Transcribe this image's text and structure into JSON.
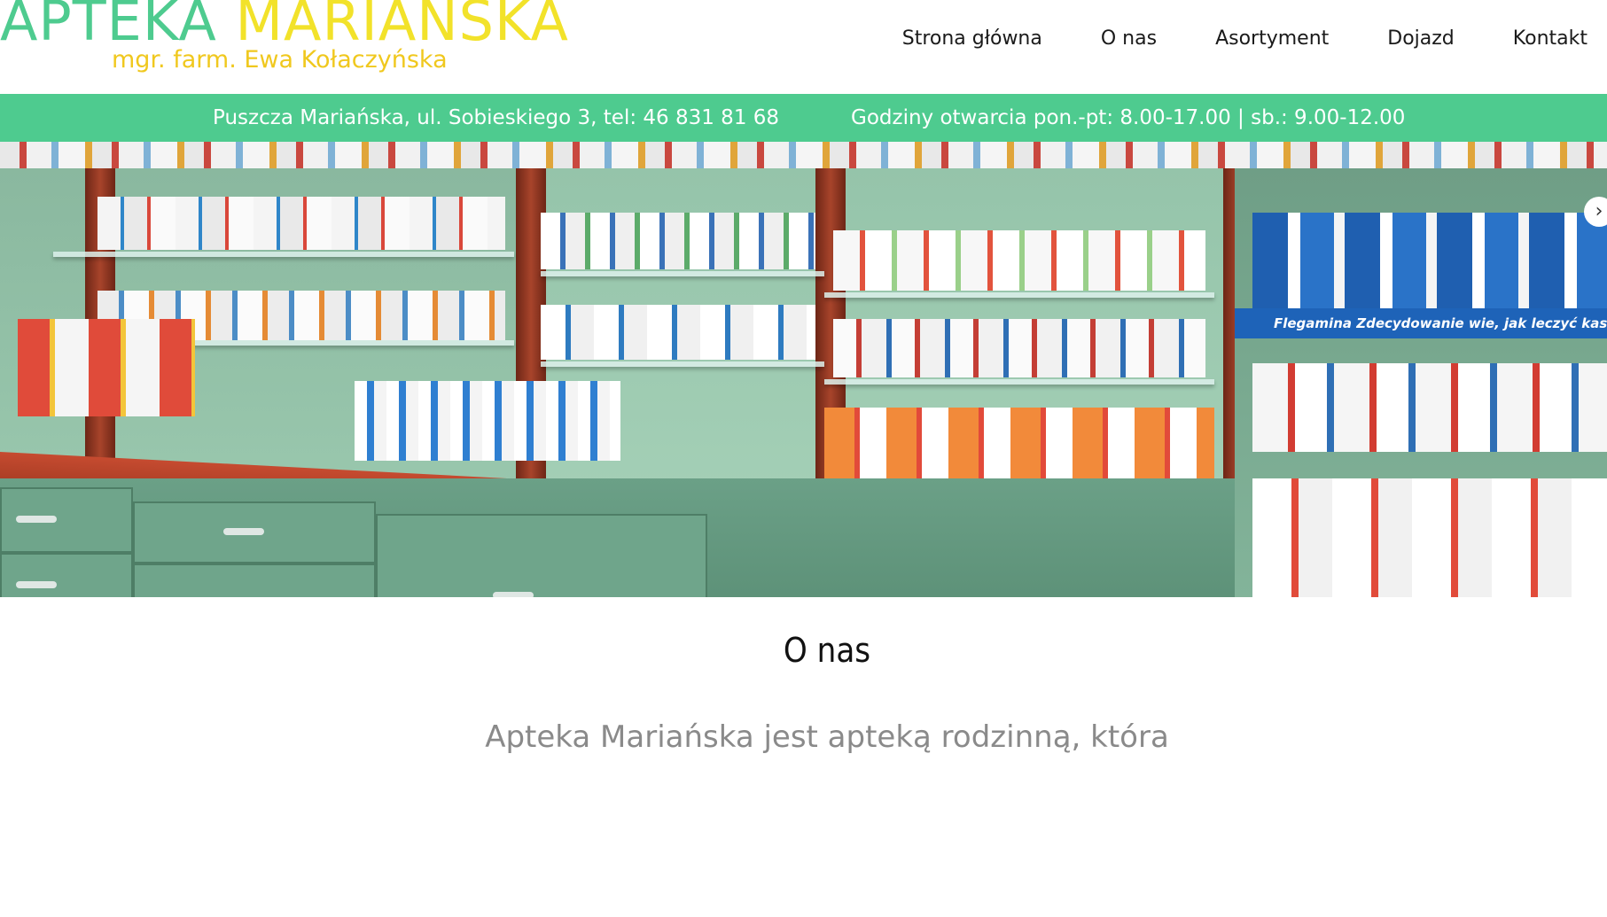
{
  "header": {
    "logo_word1": "APTEKA",
    "logo_word2": "MARIAŃSKA",
    "logo_subtitle": "mgr. farm. Ewa Kołaczyńska",
    "nav": [
      "Strona główna",
      "O nas",
      "Asortyment",
      "Dojazd",
      "Kontakt"
    ]
  },
  "infobar": {
    "address": "Puszcza Mariańska, ul. Sobieskiego 3, tel: 46 831 81 68",
    "hours": "Godziny otwarcia pon.-pt: 8.00-17.00 | sb.: 9.00-12.00"
  },
  "hero": {
    "banner_text": "Flegamina  Zdecydowanie wie, jak leczyć kaszel.",
    "next_arrow": "›"
  },
  "content": {
    "section_title": "O nas",
    "intro_text": "Apteka Mariańska jest apteką rodzinną, która"
  },
  "colors": {
    "brand_green": "#4ecb8f",
    "brand_yellow": "#f2e22a",
    "subtitle_yellow": "#f0c81e"
  }
}
